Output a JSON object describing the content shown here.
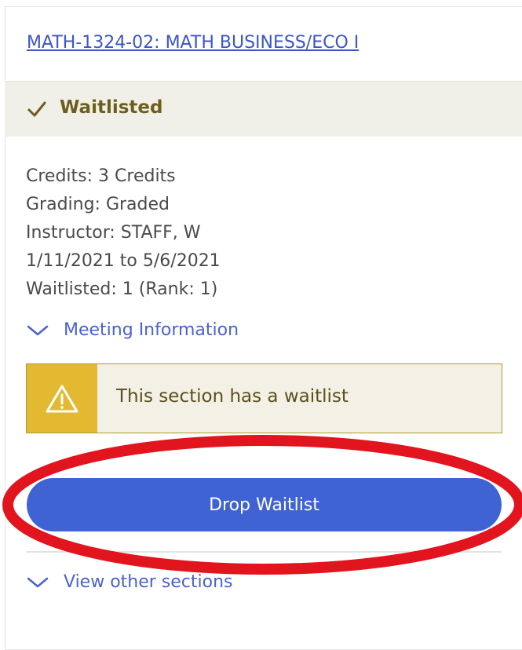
{
  "course": {
    "title": "MATH-1324-02: MATH BUSINESS/ECO I"
  },
  "status": {
    "label": "Waitlisted",
    "icon": "check-icon"
  },
  "details": {
    "credits": "Credits: 3 Credits",
    "grading": "Grading: Graded",
    "instructor": "Instructor: STAFF, W",
    "dates": "1/11/2021 to 5/6/2021",
    "waitlisted": "Waitlisted:  1 (Rank: 1)"
  },
  "meeting_toggle": {
    "label": "Meeting Information",
    "icon": "chevron-down-icon"
  },
  "alert": {
    "message": "This section has a waitlist",
    "icon": "warning-icon"
  },
  "drop_button": {
    "label": "Drop Waitlist"
  },
  "other_sections_toggle": {
    "label": "View other sections",
    "icon": "chevron-down-icon"
  },
  "colors": {
    "link": "#3d55c7",
    "status_text": "#6e5e1e",
    "status_band": "#f1f0e8",
    "alert_icon_bg": "#e2b931",
    "button": "#3f63d3",
    "annotation": "#e2141e"
  }
}
